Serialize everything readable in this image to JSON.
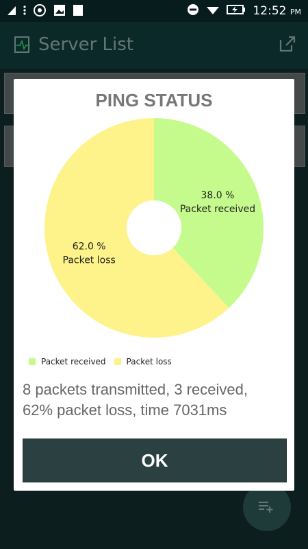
{
  "status_bar": {
    "time": "12:52",
    "ampm": "PM"
  },
  "app_bar": {
    "title": "Server List"
  },
  "dialog": {
    "title": "PING STATUS",
    "message_line1": "8 packets transmitted, 3 received,",
    "message_line2": "62% packet loss, time 7031ms",
    "ok_label": "OK"
  },
  "colors": {
    "received": "#c5fb8c",
    "loss": "#fdf38a",
    "accent_dark": "#2b4040"
  },
  "chart_data": {
    "type": "pie",
    "categories": [
      "Packet received",
      "Packet loss"
    ],
    "values": [
      38.0,
      62.0
    ],
    "value_labels": [
      "38.0 %",
      "62.0 %"
    ],
    "legend": "bottom-left",
    "hole": true
  }
}
